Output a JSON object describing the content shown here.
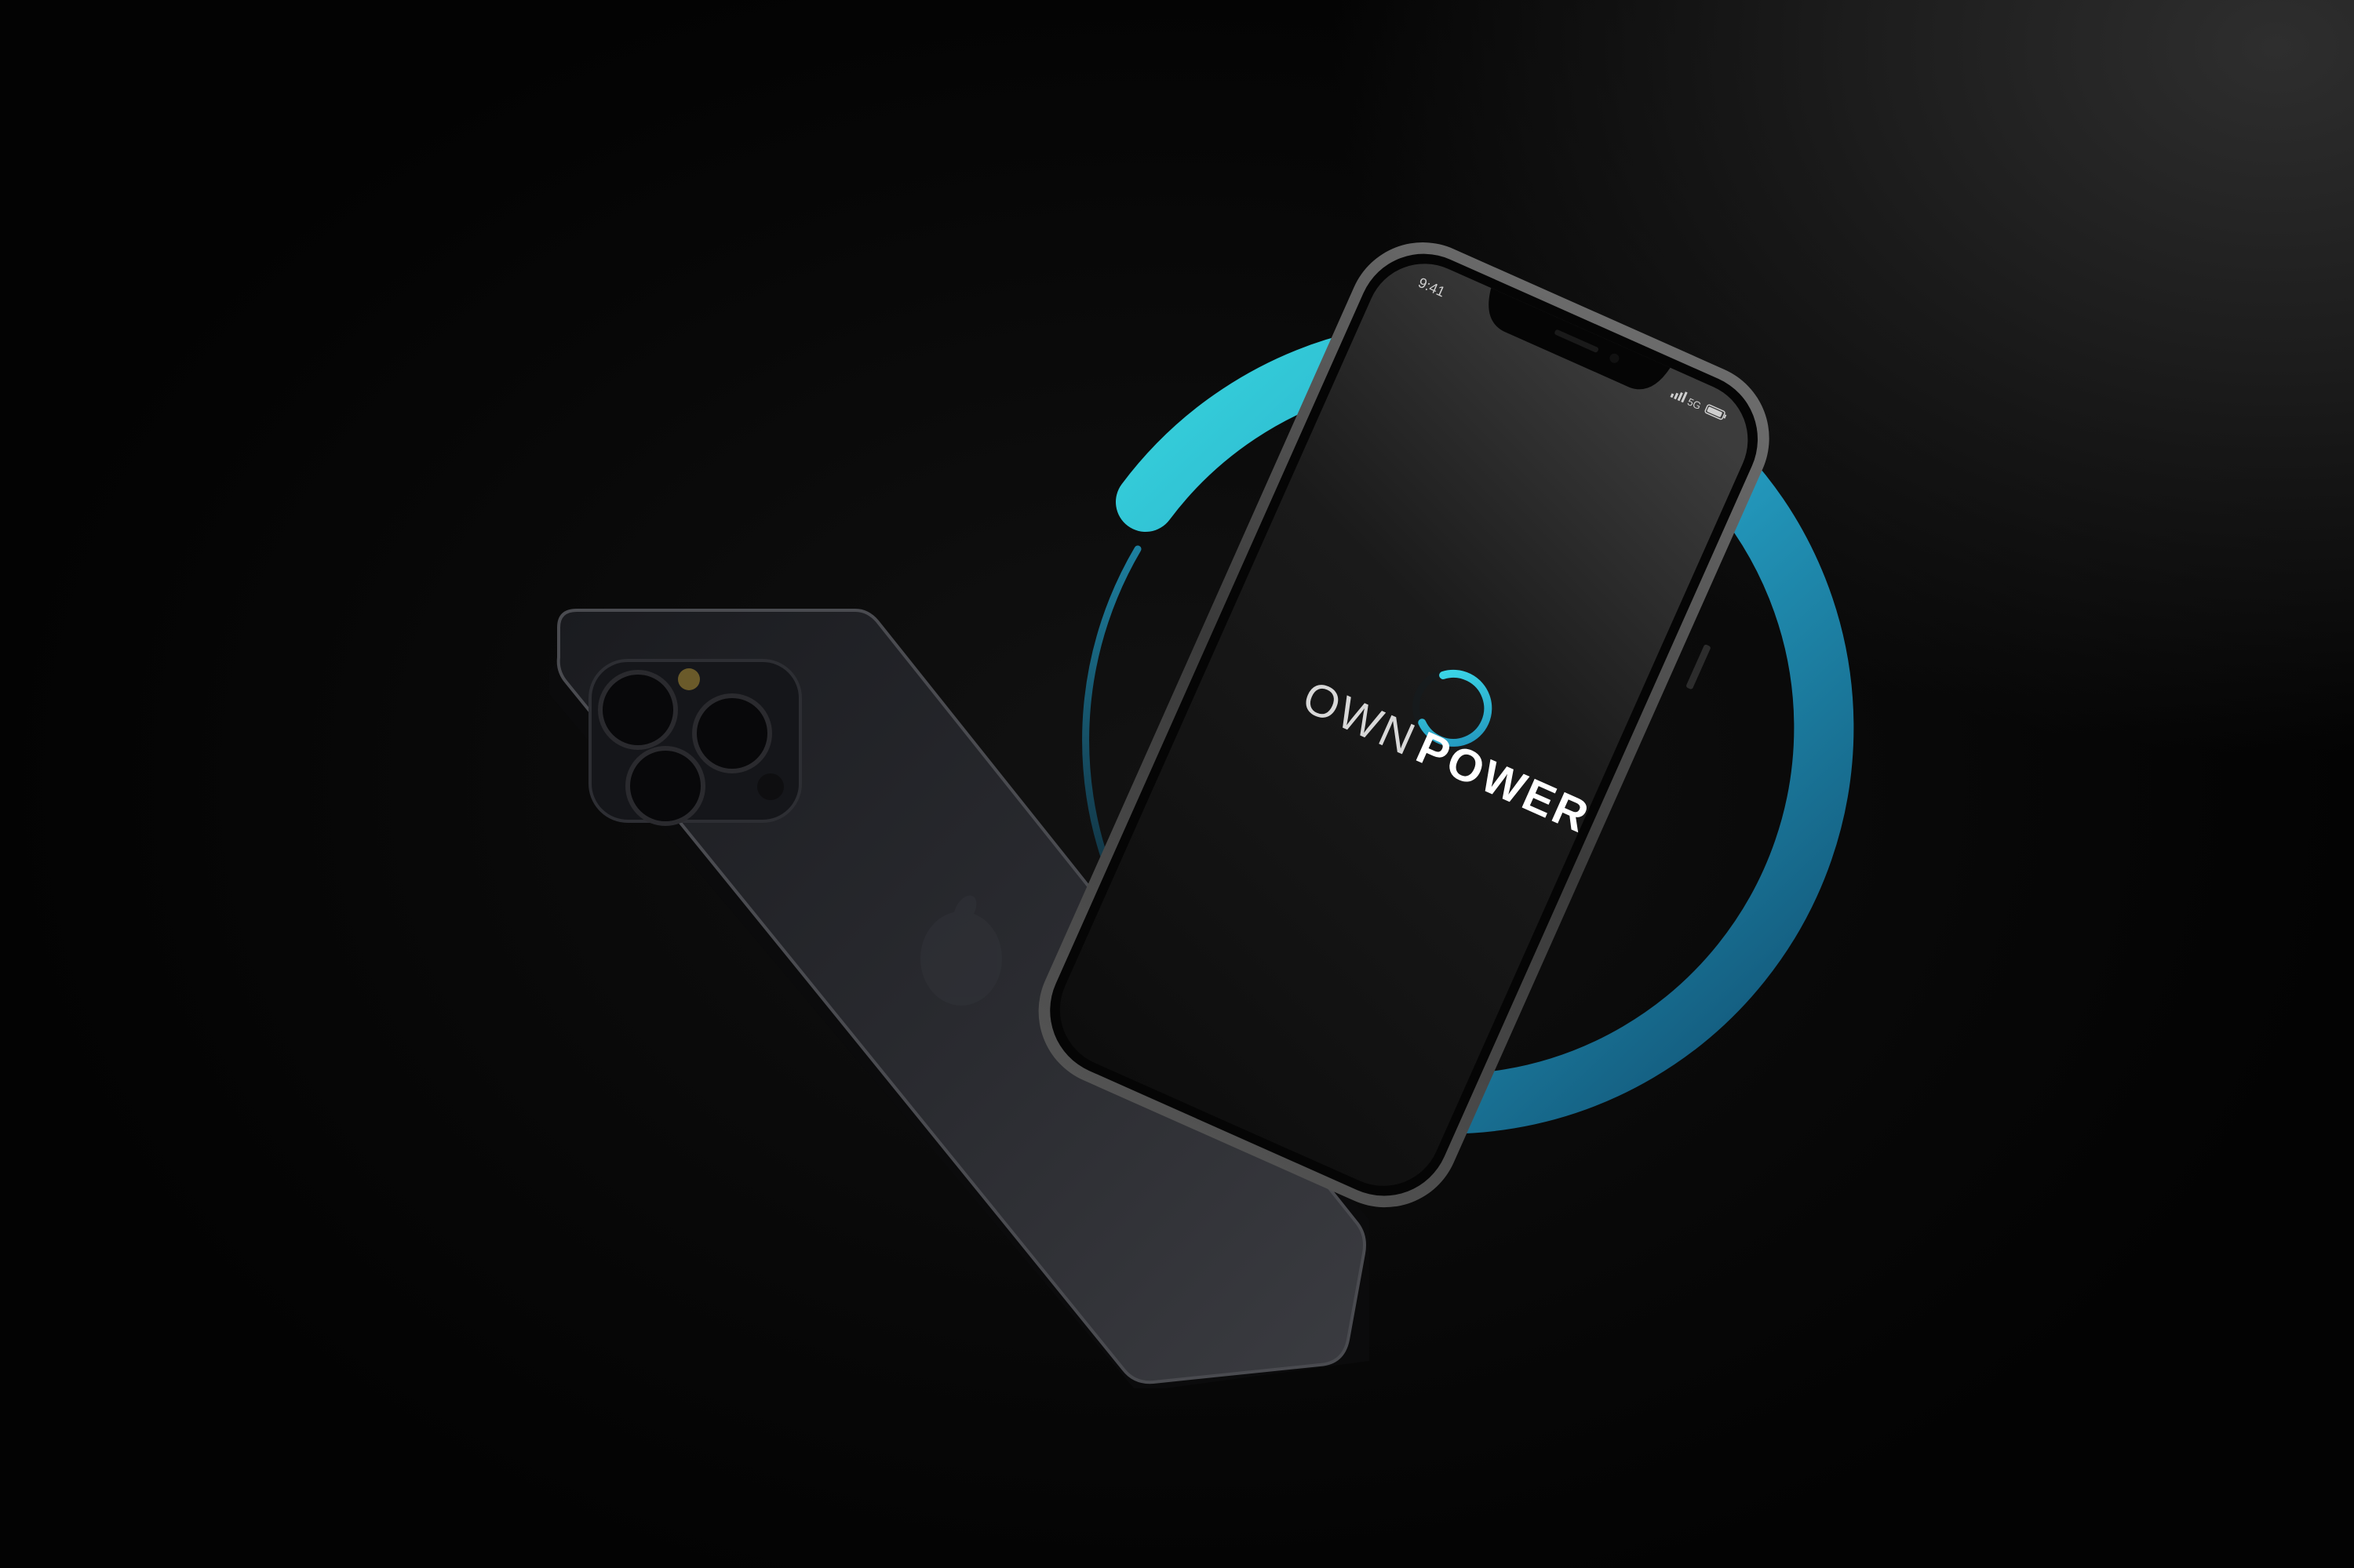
{
  "status_bar": {
    "time": "9:41",
    "network": "5G"
  },
  "app": {
    "brand_light": "OWN",
    "brand_bold": "POWER",
    "loader_icon": "loading-ring-icon"
  },
  "colors": {
    "accent_cyan": "#36d3e3",
    "accent_blue": "#1a6f92",
    "background": "#0a0a0a"
  }
}
